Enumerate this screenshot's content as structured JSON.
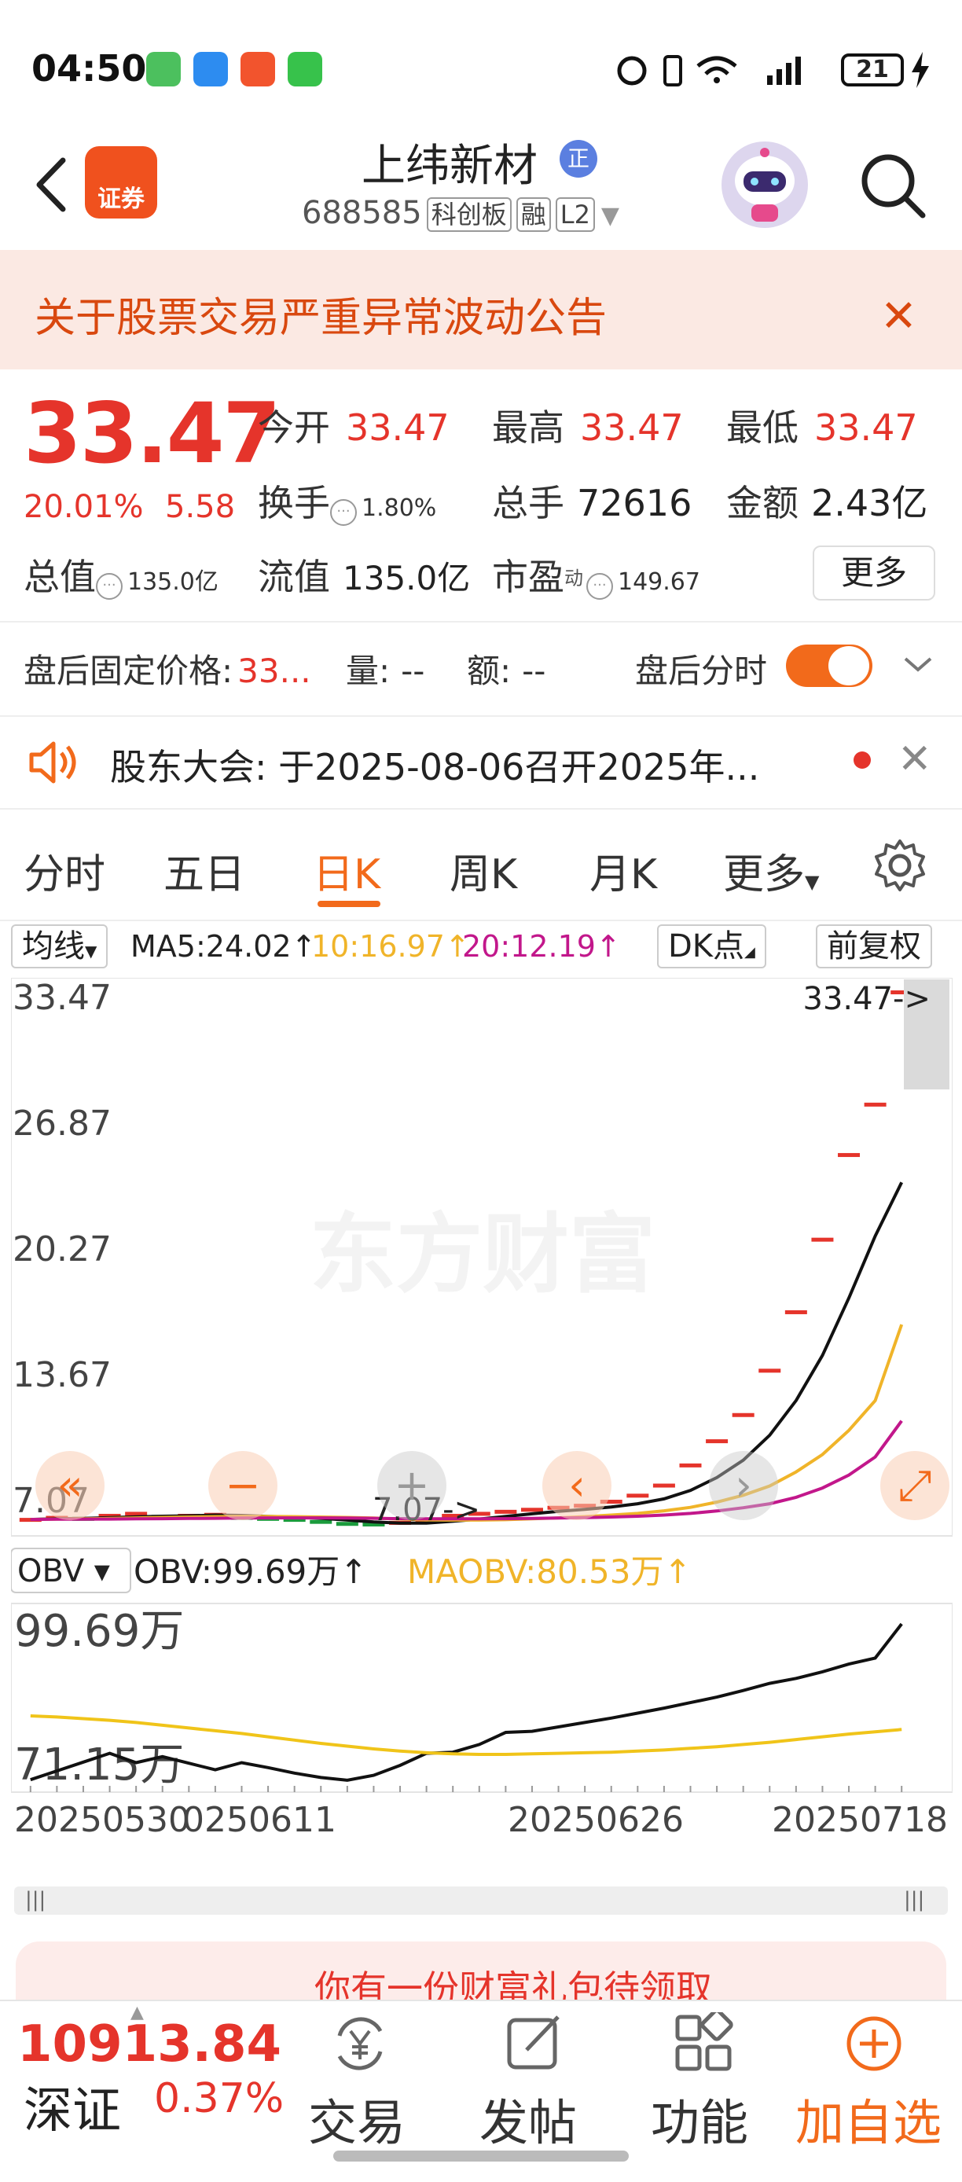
{
  "status_bar": {
    "time": "04:50",
    "battery": "21",
    "icons": [
      "alarm-icon",
      "vibrate-icon",
      "wifi-icon",
      "signal-icon",
      "charging-icon"
    ]
  },
  "header": {
    "app_badge": "证券",
    "stock_name": "上纬新材",
    "name_badge": "正",
    "stock_code": "688585",
    "tags": [
      "科创板",
      "融",
      "L2"
    ]
  },
  "banner": {
    "text": "关于股票交易严重异常波动公告"
  },
  "quote": {
    "price": "33.47",
    "change_pct": "20.01%",
    "change_amt": "5.58",
    "open_label": "今开",
    "open": "33.47",
    "high_label": "最高",
    "high": "33.47",
    "low_label": "最低",
    "low": "33.47",
    "turnover_label": "换手",
    "turnover": "1.80%",
    "volume_label": "总手",
    "volume": "72616",
    "amount_label": "金额",
    "amount": "2.43亿",
    "mktcap_label": "总值",
    "mktcap": "135.0亿",
    "float_label": "流值",
    "float_cap": "135.0亿",
    "pe_label": "市盈",
    "pe_sup": "动",
    "pe": "149.67",
    "more": "更多"
  },
  "after_hours": {
    "fixed_price_label": "盘后固定价格:",
    "fixed_price": "33...",
    "qty_label": "量:",
    "qty": "--",
    "amt_label": "额:",
    "amt": "--",
    "timeshare_label": "盘后分时",
    "toggle_on": true
  },
  "notice": {
    "text": "股东大会:  于2025-08-06召开2025年..."
  },
  "tabs": [
    "分时",
    "五日",
    "日K",
    "周K",
    "月K",
    "更多"
  ],
  "active_tab": "日K",
  "ma_row": {
    "ma_select": "均线",
    "ma5": "MA5:24.02↑",
    "ma10": "10:16.97↑",
    "ma20": "20:12.19↑",
    "dk": "DK点",
    "adjust": "前复权",
    "colors": {
      "ma5": "#111111",
      "ma10": "#f0b429",
      "ma20": "#c2178b",
      "up": "#e5342b",
      "down": "#1a9b3c"
    }
  },
  "chart_data": [
    {
      "type": "candlestick",
      "title": "",
      "y_ticks": [
        "33.47",
        "26.87",
        "20.27",
        "13.67",
        "7.07"
      ],
      "ylim": [
        7.07,
        33.47
      ],
      "high_marker": "33.47->",
      "low_marker": "7.07->",
      "watermark": "东方财富",
      "closes": [
        7.3,
        7.4,
        7.35,
        7.5,
        7.6,
        7.45,
        7.5,
        7.55,
        7.4,
        7.35,
        7.3,
        7.2,
        7.1,
        7.07,
        7.15,
        7.3,
        7.5,
        7.6,
        7.7,
        7.8,
        7.9,
        8.0,
        8.2,
        8.5,
        9.0,
        10.0,
        11.2,
        12.5,
        14.7,
        17.6,
        21.2,
        25.4,
        27.9,
        33.47
      ],
      "series": [
        {
          "name": "MA5",
          "values": [
            7.3,
            7.34,
            7.35,
            7.39,
            7.43,
            7.46,
            7.48,
            7.52,
            7.5,
            7.45,
            7.42,
            7.36,
            7.27,
            7.18,
            7.12,
            7.12,
            7.21,
            7.32,
            7.45,
            7.58,
            7.7,
            7.8,
            7.92,
            8.08,
            8.32,
            8.74,
            9.38,
            10.24,
            11.48,
            13.2,
            15.44,
            18.28,
            21.36,
            24.02
          ]
        },
        {
          "name": "MA10",
          "values": [
            7.3,
            7.32,
            7.33,
            7.35,
            7.38,
            7.4,
            7.42,
            7.44,
            7.45,
            7.45,
            7.44,
            7.42,
            7.4,
            7.37,
            7.32,
            7.28,
            7.27,
            7.27,
            7.29,
            7.33,
            7.38,
            7.44,
            7.52,
            7.6,
            7.73,
            7.9,
            8.16,
            8.5,
            8.96,
            9.66,
            10.52,
            11.72,
            13.2,
            16.97
          ]
        },
        {
          "name": "MA20",
          "values": [
            7.3,
            7.31,
            7.31,
            7.32,
            7.33,
            7.34,
            7.35,
            7.36,
            7.37,
            7.38,
            7.38,
            7.38,
            7.37,
            7.36,
            7.34,
            7.33,
            7.33,
            7.33,
            7.34,
            7.35,
            7.37,
            7.39,
            7.42,
            7.46,
            7.52,
            7.6,
            7.72,
            7.88,
            8.08,
            8.4,
            8.86,
            9.5,
            10.4,
            12.19
          ]
        }
      ]
    },
    {
      "type": "line",
      "title": "",
      "indicator": "OBV",
      "obv_label": "OBV:99.69万↑",
      "maobv_label": "MAOBV:80.53万↑",
      "y_ticks": [
        "99.69万",
        "71.15万"
      ],
      "ylim": [
        71.15,
        99.69
      ],
      "x_ticks": [
        "20250530",
        "0250611",
        "20250626",
        "20250718"
      ],
      "series": [
        {
          "name": "OBV",
          "values": [
            71.4,
            73.0,
            74.6,
            76.2,
            74.5,
            75.6,
            74.4,
            73.2,
            74.5,
            73.6,
            72.6,
            71.8,
            71.3,
            72.2,
            74.0,
            76.2,
            76.4,
            77.8,
            80.0,
            80.2,
            81.0,
            81.8,
            82.6,
            83.5,
            84.4,
            85.4,
            86.4,
            87.6,
            88.9,
            89.8,
            91.0,
            92.4,
            93.5,
            99.69
          ]
        },
        {
          "name": "MAOBV",
          "values": [
            83.0,
            82.8,
            82.5,
            82.2,
            81.8,
            81.3,
            80.8,
            80.3,
            79.8,
            79.2,
            78.6,
            78.0,
            77.5,
            77.0,
            76.6,
            76.3,
            76.1,
            76.0,
            76.0,
            76.1,
            76.2,
            76.3,
            76.4,
            76.6,
            76.8,
            77.1,
            77.4,
            77.8,
            78.2,
            78.7,
            79.2,
            79.7,
            80.1,
            80.53
          ]
        }
      ]
    }
  ],
  "chart_controls": {
    "indicator_select": "OBV",
    "scroll_left": "|||",
    "scroll_right": "|||"
  },
  "gift": {
    "text": "你有一份财富礼包待领取"
  },
  "bottom": {
    "index_value": "10913.84",
    "index_name": "深证",
    "index_pct": "0.37%",
    "nav": [
      {
        "label": "交易",
        "icon": "yen-exchange-icon"
      },
      {
        "label": "发帖",
        "icon": "edit-icon"
      },
      {
        "label": "功能",
        "icon": "grid-icon"
      },
      {
        "label": "加自选",
        "icon": "plus-circle-icon"
      }
    ]
  }
}
